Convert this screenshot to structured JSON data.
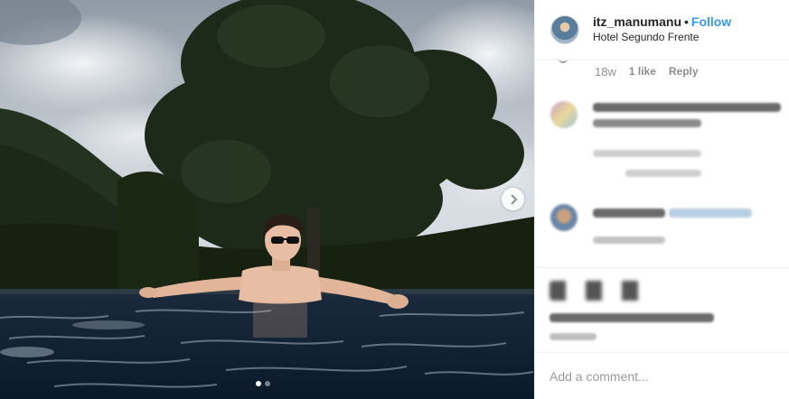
{
  "post": {
    "username": "itz_manumanu",
    "separator": "•",
    "follow_label": "Follow",
    "location": "Hotel Segundo Frente"
  },
  "comment_meta": {
    "age": "18w",
    "likes": "1 like",
    "reply_label": "Reply"
  },
  "composer": {
    "placeholder": "Add a comment..."
  },
  "carousel": {
    "slide_count": 2,
    "active_slide": 1
  },
  "colors": {
    "accent": "#3897f0",
    "muted": "#8e8e8e",
    "text": "#262626"
  },
  "icons": {
    "next": "chevron-right-icon",
    "like": "heart-icon",
    "comment": "comment-icon",
    "share": "share-icon"
  }
}
